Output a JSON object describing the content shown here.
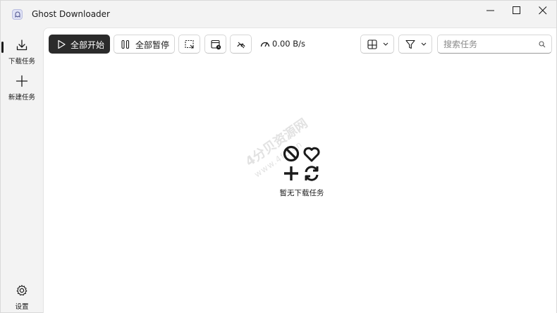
{
  "window": {
    "title": "Ghost Downloader",
    "app_icon": "ghost-app-icon",
    "controls": [
      "minimize-icon",
      "maximize-icon",
      "close-icon"
    ]
  },
  "sidebar": {
    "items": [
      {
        "id": "downloads",
        "label": "下载任务",
        "icon": "download-icon",
        "active": true
      },
      {
        "id": "new",
        "label": "新建任务",
        "icon": "plus-icon",
        "active": false
      }
    ],
    "footer": {
      "label": "设置",
      "icon": "gear-icon"
    }
  },
  "toolbar": {
    "start_all": "全部开始",
    "pause_all": "全部暂停",
    "speed": "0.00 B/s",
    "search": {
      "placeholder": "搜索任务",
      "value": ""
    }
  },
  "empty_state": {
    "text": "暂无下载任务",
    "icons": [
      "no-entry-icon",
      "heart-icon",
      "plus-icon",
      "refresh-icon"
    ]
  },
  "watermark": {
    "text": "4分贝资源网",
    "url": "www.4fb.cn"
  },
  "colors": {
    "accent": "#2b2b2b",
    "window_bg": "#f3f3f3",
    "content_bg": "#ffffff"
  }
}
